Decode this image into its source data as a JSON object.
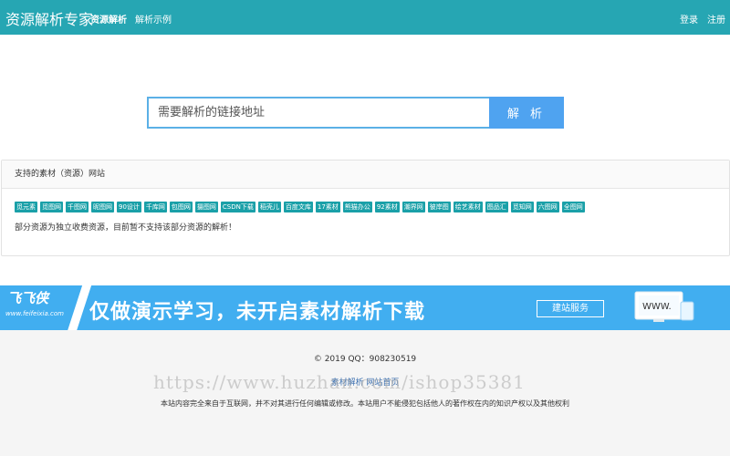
{
  "header": {
    "brand": "资源解析专家",
    "nav": [
      "资源解析",
      "解析示例"
    ],
    "login": "登录",
    "register": "注册"
  },
  "search": {
    "placeholder": "需要解析的链接地址",
    "button": "解 析"
  },
  "panel": {
    "title": "支持的素材（资源）网站",
    "tags": [
      "觅元素",
      "觅图网",
      "千图网",
      "昵图网",
      "90设计",
      "千库网",
      "包图网",
      "摄图网",
      "CSDN下载",
      "稻壳儿",
      "百度文库",
      "17素材",
      "熊猫办公",
      "92素材",
      "潮界网",
      "彼岸图",
      "绘艺素材",
      "图品汇",
      "觅知网",
      "六图网",
      "全图网"
    ],
    "note": "部分资源为独立收费资源，目前暂不支持该部分资源的解析！"
  },
  "banner": {
    "logo": "飞飞侠",
    "logo_url": "www.feifeixia.com",
    "text": "仅做演示学习，未开启素材解析下载",
    "button": "建站服务",
    "monitor_text": "WWW."
  },
  "footer": {
    "copyright": "© 2019 QQ：908230519",
    "link": "素材解析 网站首页",
    "disclaimer": "本站内容完全来自于互联网，并不对其进行任何编辑或修改。本站用户不能侵犯包括他人的著作权在内的知识产权以及其他权利"
  },
  "watermark": "https://www.huzhan.com/ishop35381",
  "colors": {
    "header_bg": "#26a6b3",
    "search_btn": "#4fa3f0",
    "tag_bg": "#1aa0a8",
    "banner_bg": "#41aef0"
  }
}
